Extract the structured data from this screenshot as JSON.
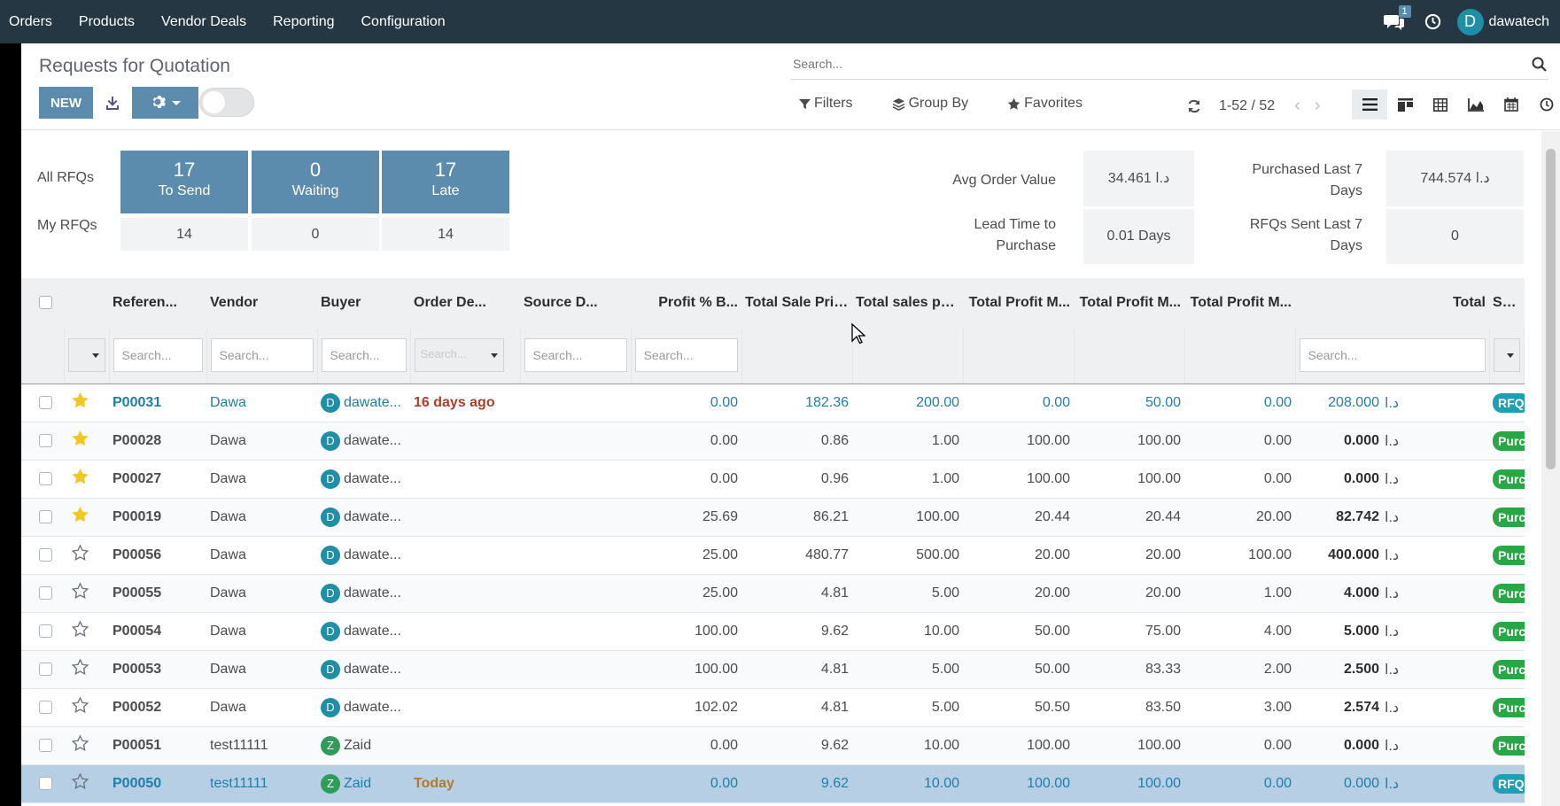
{
  "topbar": {
    "menu": [
      "Orders",
      "Products",
      "Vendor Deals",
      "Reporting",
      "Configuration"
    ],
    "chat_count": "1",
    "user_initial": "D",
    "user_name": "dawatech"
  },
  "control": {
    "title": "Requests for Quotation",
    "new_label": "NEW",
    "search_placeholder": "Search...",
    "filters_label": "Filters",
    "groupby_label": "Group By",
    "favorites_label": "Favorites",
    "pager": "1-52 / 52"
  },
  "dashboard": {
    "all_rfqs_label": "All RFQs",
    "my_rfqs_label": "My RFQs",
    "tiles": [
      {
        "num": "17",
        "label": "To Send",
        "my": "14"
      },
      {
        "num": "0",
        "label": "Waiting",
        "my": "0"
      },
      {
        "num": "17",
        "label": "Late",
        "my": "14"
      }
    ],
    "kpis": [
      {
        "label": "Avg Order Value",
        "value": "34.461  د.ا"
      },
      {
        "label": "Lead Time to Purchase",
        "value": "0.01 Days"
      },
      {
        "label": "Purchased Last 7 Days",
        "value": "744.574  د.ا"
      },
      {
        "label": "RFQs Sent Last 7 Days",
        "value": "0"
      }
    ]
  },
  "table": {
    "columns": [
      "Referen...",
      "Vendor",
      "Buyer",
      "Order De...",
      "Source D...",
      "Profit % B...",
      "Total Sale Pric...",
      "Total sales pri...",
      "Total Profit M...",
      "Total Profit M...",
      "Total Profit M...",
      "Total",
      "Status"
    ],
    "filter_placeholder": "Search...",
    "currency": "د.ا",
    "rows": [
      {
        "ref": "P00031",
        "vendor": "Dawa",
        "buyer": "dawate...",
        "bi": "D",
        "date": "16 days ago",
        "profit": "0.00",
        "tsp": "182.36",
        "tsp2": "200.00",
        "tpm1": "0.00",
        "tpm2": "50.00",
        "tpm3": "0.00",
        "total": "208.000",
        "status": "RFQ",
        "starred": true
      },
      {
        "ref": "P00028",
        "vendor": "Dawa",
        "buyer": "dawate...",
        "bi": "D",
        "date": "",
        "profit": "0.00",
        "tsp": "0.86",
        "tsp2": "1.00",
        "tpm1": "100.00",
        "tpm2": "100.00",
        "tpm3": "0.00",
        "total": "0.000",
        "status": "Purchase Order",
        "starred": true
      },
      {
        "ref": "P00027",
        "vendor": "Dawa",
        "buyer": "dawate...",
        "bi": "D",
        "date": "",
        "profit": "0.00",
        "tsp": "0.96",
        "tsp2": "1.00",
        "tpm1": "100.00",
        "tpm2": "100.00",
        "tpm3": "0.00",
        "total": "0.000",
        "status": "Purchase Order",
        "starred": true
      },
      {
        "ref": "P00019",
        "vendor": "Dawa",
        "buyer": "dawate...",
        "bi": "D",
        "date": "",
        "profit": "25.69",
        "tsp": "86.21",
        "tsp2": "100.00",
        "tpm1": "20.44",
        "tpm2": "20.44",
        "tpm3": "20.00",
        "total": "82.742",
        "status": "Purchase Order",
        "starred": true
      },
      {
        "ref": "P00056",
        "vendor": "Dawa",
        "buyer": "dawate...",
        "bi": "D",
        "date": "",
        "profit": "25.00",
        "tsp": "480.77",
        "tsp2": "500.00",
        "tpm1": "20.00",
        "tpm2": "20.00",
        "tpm3": "100.00",
        "total": "400.000",
        "status": "Purchase Order",
        "starred": false
      },
      {
        "ref": "P00055",
        "vendor": "Dawa",
        "buyer": "dawate...",
        "bi": "D",
        "date": "",
        "profit": "25.00",
        "tsp": "4.81",
        "tsp2": "5.00",
        "tpm1": "20.00",
        "tpm2": "20.00",
        "tpm3": "1.00",
        "total": "4.000",
        "status": "Purchase Order",
        "starred": false
      },
      {
        "ref": "P00054",
        "vendor": "Dawa",
        "buyer": "dawate...",
        "bi": "D",
        "date": "",
        "profit": "100.00",
        "tsp": "9.62",
        "tsp2": "10.00",
        "tpm1": "50.00",
        "tpm2": "75.00",
        "tpm3": "4.00",
        "total": "5.000",
        "status": "Purchase Order",
        "starred": false
      },
      {
        "ref": "P00053",
        "vendor": "Dawa",
        "buyer": "dawate...",
        "bi": "D",
        "date": "",
        "profit": "100.00",
        "tsp": "4.81",
        "tsp2": "5.00",
        "tpm1": "50.00",
        "tpm2": "83.33",
        "tpm3": "2.00",
        "total": "2.500",
        "status": "Purchase Order",
        "starred": false
      },
      {
        "ref": "P00052",
        "vendor": "Dawa",
        "buyer": "dawate...",
        "bi": "D",
        "date": "",
        "profit": "102.02",
        "tsp": "4.81",
        "tsp2": "5.00",
        "tpm1": "50.50",
        "tpm2": "83.50",
        "tpm3": "3.00",
        "total": "2.574",
        "status": "Purchase Order",
        "starred": false
      },
      {
        "ref": "P00051",
        "vendor": "test11111",
        "buyer": "Zaid",
        "bi": "Z",
        "date": "",
        "profit": "0.00",
        "tsp": "9.62",
        "tsp2": "10.00",
        "tpm1": "100.00",
        "tpm2": "100.00",
        "tpm3": "0.00",
        "total": "0.000",
        "status": "Purchase Order",
        "starred": false
      },
      {
        "ref": "P00050",
        "vendor": "test11111",
        "buyer": "Zaid",
        "bi": "Z",
        "date": "Today",
        "profit": "0.00",
        "tsp": "9.62",
        "tsp2": "10.00",
        "tpm1": "100.00",
        "tpm2": "100.00",
        "tpm3": "0.00",
        "total": "0.000",
        "status": "RFQ",
        "starred": false
      }
    ]
  }
}
